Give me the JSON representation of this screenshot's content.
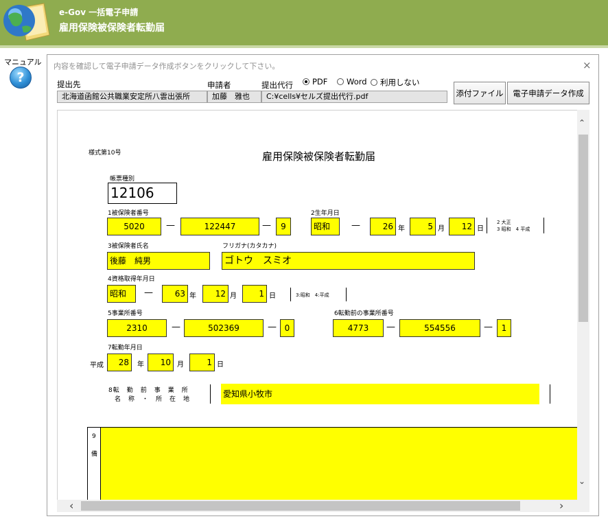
{
  "header": {
    "app_title": "e-Gov 一括電子申請",
    "form_title": "雇用保険被保険者転勤届"
  },
  "sidebar": {
    "manual_label": "マニュアル",
    "help_glyph": "?"
  },
  "dialog": {
    "instruction": "内容を確認して電子申請データ作成ボタンをクリックして下さい。",
    "close_glyph": "×",
    "submit_to_label": "提出先",
    "submit_to_value": "北海道函館公共職業安定所八雲出張所",
    "applicant_label": "申請者",
    "applicant_value": "加藤　雅也",
    "proxy_label": "提出代行",
    "proxy_value": "C:¥cells¥セルズ提出代行.pdf",
    "radio_options": [
      "PDF",
      "Word",
      "利用しない"
    ],
    "radio_selected": "PDF",
    "attach_button": "添付ファイル",
    "create_button": "電子申請データ作成"
  },
  "form": {
    "form_number": "様式第10号",
    "title": "雇用保険被保険者転勤届",
    "doc_type_label": "帳票種別",
    "doc_type_value": "12106",
    "f1_label": "1被保険者番号",
    "f1_values": [
      "5020",
      "122447",
      "9"
    ],
    "f2_label": "2生年月日",
    "f2_era": "昭和",
    "f2_year": "26",
    "f2_month": "5",
    "f2_day": "12",
    "f2_era_note_1": "2 大正",
    "f2_era_note_2": "3 昭和　4 平成",
    "f3_label": "3被保険者氏名",
    "f3_value": "後藤　純男",
    "furigana_label": "フリガナ(カタカナ)",
    "furigana_value": "ゴトウ　スミオ",
    "f4_label": "4資格取得年月日",
    "f4_era": "昭和",
    "f4_year": "63",
    "f4_month": "12",
    "f4_day": "1",
    "f4_era_note": "3:昭和　4:平成",
    "f5_label": "5事業所番号",
    "f5_values": [
      "2310",
      "502369",
      "0"
    ],
    "f6_label": "6転勤前の事業所番号",
    "f6_values": [
      "4773",
      "554556",
      "1"
    ],
    "f7_label": "7転勤年月日",
    "f7_era": "平成",
    "f7_year": "28",
    "f7_month": "10",
    "f7_day": "1",
    "f8_label_1": "8転　勤　前　事　業　所",
    "f8_label_2": "名　称　・　所　在　地",
    "f8_value": "愛知県小牧市",
    "f9_label_1": "9",
    "f9_label_2": "備",
    "units": {
      "year": "年",
      "month": "月",
      "day": "日"
    },
    "dash": "—"
  },
  "scroll": {
    "up": "⌃",
    "down": "⌄",
    "left": "‹",
    "right": "›"
  },
  "colors": {
    "header": "#8fac4f",
    "field": "#ffff00"
  }
}
